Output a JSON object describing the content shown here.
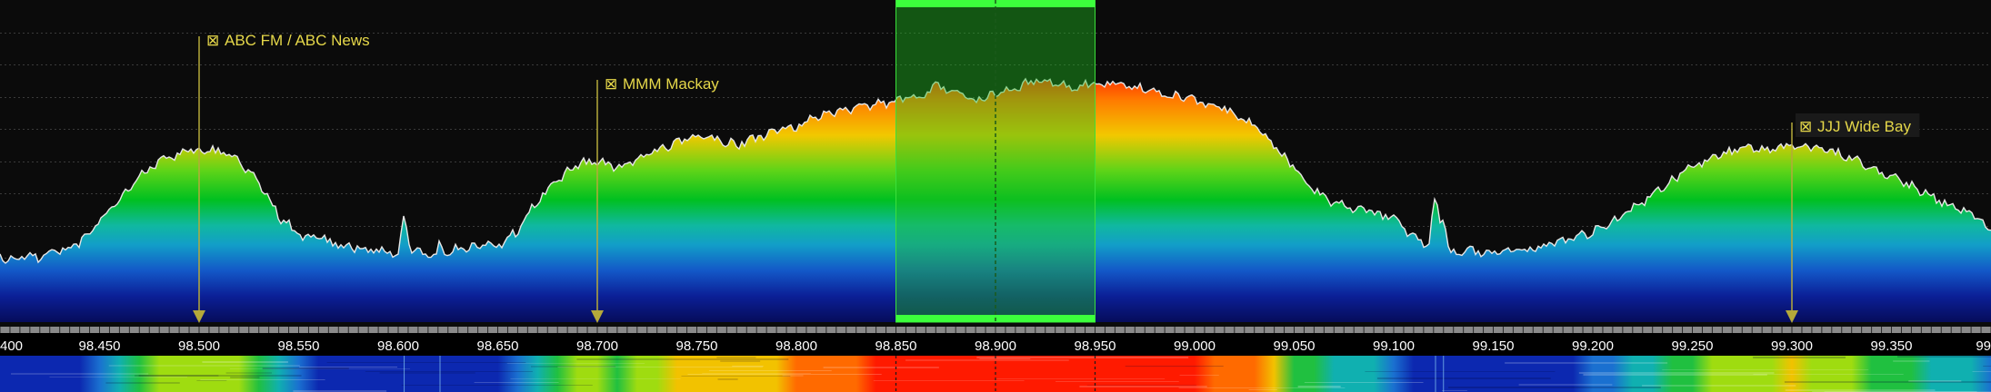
{
  "app": {
    "colors": {
      "background": "#0b0b0b",
      "trace": "#e6e6e6",
      "vfo_fill": "#1fbf1f",
      "vfo_bar": "#3cff3c",
      "marker": "#b5a93a",
      "marker_label": "#e6d84a"
    }
  },
  "spectrum": {
    "freq_start": 98.4,
    "freq_end": 99.4,
    "vfo": {
      "center": 98.9,
      "low": 98.85,
      "high": 98.95
    },
    "noise_level_fraction": 0.8,
    "profile": [
      [
        98.4,
        0.8
      ],
      [
        98.41,
        0.8
      ],
      [
        98.42,
        0.8
      ],
      [
        98.43,
        0.78
      ],
      [
        98.44,
        0.75
      ],
      [
        98.45,
        0.69
      ],
      [
        98.46,
        0.62
      ],
      [
        98.47,
        0.55
      ],
      [
        98.48,
        0.5
      ],
      [
        98.49,
        0.48
      ],
      [
        98.5,
        0.46
      ],
      [
        98.51,
        0.47
      ],
      [
        98.52,
        0.5
      ],
      [
        98.53,
        0.56
      ],
      [
        98.54,
        0.67
      ],
      [
        98.55,
        0.73
      ],
      [
        98.56,
        0.74
      ],
      [
        98.57,
        0.76
      ],
      [
        98.58,
        0.77
      ],
      [
        98.59,
        0.78
      ],
      [
        98.6,
        0.79
      ],
      [
        98.61,
        0.78
      ],
      [
        98.62,
        0.79
      ],
      [
        98.63,
        0.77
      ],
      [
        98.64,
        0.76
      ],
      [
        98.65,
        0.76
      ],
      [
        98.66,
        0.72
      ],
      [
        98.67,
        0.62
      ],
      [
        98.68,
        0.56
      ],
      [
        98.69,
        0.51
      ],
      [
        98.7,
        0.5
      ],
      [
        98.71,
        0.52
      ],
      [
        98.72,
        0.49
      ],
      [
        98.73,
        0.47
      ],
      [
        98.74,
        0.44
      ],
      [
        98.75,
        0.43
      ],
      [
        98.76,
        0.43
      ],
      [
        98.77,
        0.45
      ],
      [
        98.78,
        0.43
      ],
      [
        98.79,
        0.41
      ],
      [
        98.8,
        0.39
      ],
      [
        98.81,
        0.36
      ],
      [
        98.82,
        0.35
      ],
      [
        98.83,
        0.33
      ],
      [
        98.84,
        0.32
      ],
      [
        98.85,
        0.32
      ],
      [
        98.86,
        0.3
      ],
      [
        98.87,
        0.27
      ],
      [
        98.88,
        0.28
      ],
      [
        98.89,
        0.31
      ],
      [
        98.9,
        0.29
      ],
      [
        98.91,
        0.27
      ],
      [
        98.92,
        0.25
      ],
      [
        98.93,
        0.26
      ],
      [
        98.94,
        0.27
      ],
      [
        98.95,
        0.26
      ],
      [
        98.96,
        0.26
      ],
      [
        98.97,
        0.27
      ],
      [
        98.98,
        0.29
      ],
      [
        98.99,
        0.3
      ],
      [
        99.0,
        0.31
      ],
      [
        99.01,
        0.33
      ],
      [
        99.02,
        0.35
      ],
      [
        99.03,
        0.39
      ],
      [
        99.04,
        0.45
      ],
      [
        99.05,
        0.52
      ],
      [
        99.06,
        0.59
      ],
      [
        99.07,
        0.63
      ],
      [
        99.08,
        0.65
      ],
      [
        99.09,
        0.66
      ],
      [
        99.1,
        0.68
      ],
      [
        99.11,
        0.74
      ],
      [
        99.12,
        0.76
      ],
      [
        99.13,
        0.78
      ],
      [
        99.14,
        0.78
      ],
      [
        99.15,
        0.78
      ],
      [
        99.16,
        0.78
      ],
      [
        99.17,
        0.77
      ],
      [
        99.18,
        0.76
      ],
      [
        99.19,
        0.74
      ],
      [
        99.2,
        0.72
      ],
      [
        99.21,
        0.69
      ],
      [
        99.22,
        0.65
      ],
      [
        99.23,
        0.6
      ],
      [
        99.24,
        0.56
      ],
      [
        99.25,
        0.52
      ],
      [
        99.26,
        0.49
      ],
      [
        99.27,
        0.47
      ],
      [
        99.28,
        0.46
      ],
      [
        99.29,
        0.46
      ],
      [
        99.3,
        0.45
      ],
      [
        99.31,
        0.46
      ],
      [
        99.32,
        0.47
      ],
      [
        99.33,
        0.49
      ],
      [
        99.34,
        0.52
      ],
      [
        99.35,
        0.55
      ],
      [
        99.36,
        0.58
      ],
      [
        99.37,
        0.61
      ],
      [
        99.38,
        0.64
      ],
      [
        99.39,
        0.67
      ],
      [
        99.4,
        0.71
      ]
    ],
    "spikes": [
      {
        "freq": 98.603,
        "level_fraction": 0.66
      },
      {
        "freq": 98.621,
        "level_fraction": 0.73
      },
      {
        "freq": 99.121,
        "level_fraction": 0.6
      },
      {
        "freq": 99.125,
        "level_fraction": 0.67
      }
    ]
  },
  "axis": {
    "ticks": [
      {
        "value": 98.4,
        "label": "400"
      },
      {
        "value": 98.45,
        "label": "98.450"
      },
      {
        "value": 98.5,
        "label": "98.500"
      },
      {
        "value": 98.55,
        "label": "98.550"
      },
      {
        "value": 98.6,
        "label": "98.600"
      },
      {
        "value": 98.65,
        "label": "98.650"
      },
      {
        "value": 98.7,
        "label": "98.700"
      },
      {
        "value": 98.75,
        "label": "98.750"
      },
      {
        "value": 98.8,
        "label": "98.800"
      },
      {
        "value": 98.85,
        "label": "98.850"
      },
      {
        "value": 98.9,
        "label": "98.900"
      },
      {
        "value": 98.95,
        "label": "98.950"
      },
      {
        "value": 99.0,
        "label": "99.000"
      },
      {
        "value": 99.05,
        "label": "99.050"
      },
      {
        "value": 99.1,
        "label": "99.100"
      },
      {
        "value": 99.15,
        "label": "99.150"
      },
      {
        "value": 99.2,
        "label": "99.200"
      },
      {
        "value": 99.25,
        "label": "99.250"
      },
      {
        "value": 99.3,
        "label": "99.300"
      },
      {
        "value": 99.35,
        "label": "99.350"
      },
      {
        "value": 99.4,
        "label": "99"
      }
    ]
  },
  "stations": [
    {
      "id": "abc-fm",
      "freq": 98.5,
      "label": "ABC FM / ABC News",
      "checkbox": "⊠",
      "tier": 0
    },
    {
      "id": "mmm-mackay",
      "freq": 98.7,
      "label": "MMM Mackay",
      "checkbox": "⊠",
      "tier": 1
    },
    {
      "id": "jjj-wide-bay",
      "freq": 99.3,
      "label": "JJJ Wide Bay",
      "checkbox": "⊠",
      "tier": 2
    }
  ]
}
